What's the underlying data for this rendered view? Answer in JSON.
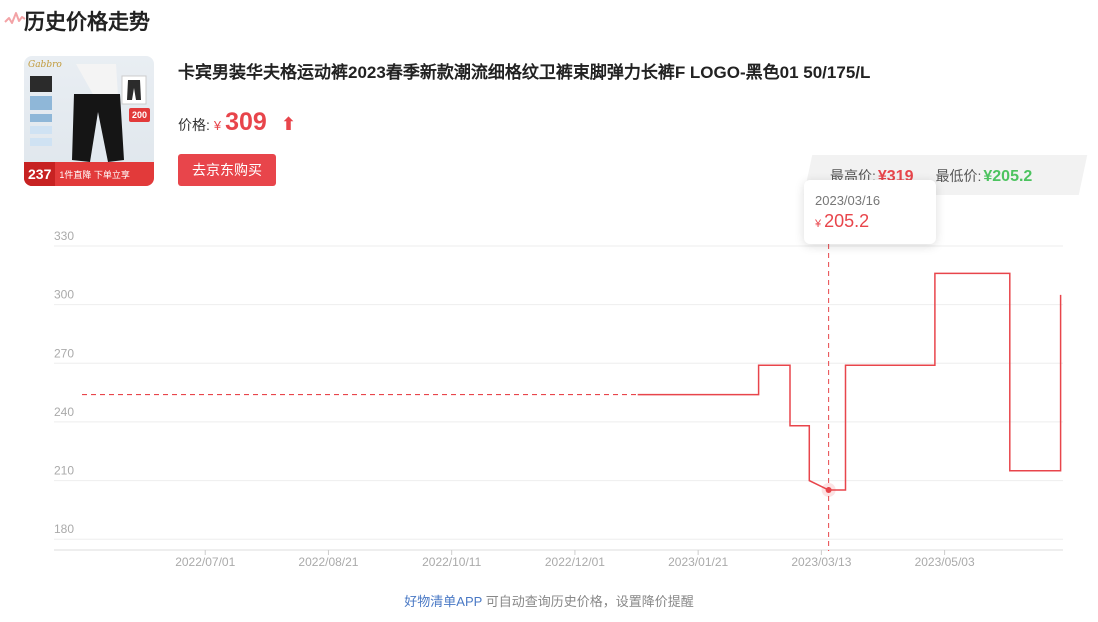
{
  "page": {
    "title": "历史价格走势"
  },
  "product": {
    "image_brand_text": "Gabbro",
    "image_badge": "200",
    "image_price": "237",
    "image_promo": "1件直降 下单立享",
    "title": "卡宾男装华夫格运动裤2023春季新款潮流细格纹卫裤束脚弹力长裤F LOGO-黑色01 50/175/L",
    "price_label": "价格:",
    "currency": "¥",
    "price": "309",
    "buy_button": "去京东购买"
  },
  "summary": {
    "high_label": "最高价:",
    "high_value": "¥319",
    "low_label": "最低价:",
    "low_value": "¥205.2"
  },
  "tooltip": {
    "date": "2023/03/16",
    "currency": "¥",
    "price": "205.2"
  },
  "footer": {
    "link": "好物清单APP",
    "text": " 可自动查询历史价格，设置降价提醒"
  },
  "colors": {
    "line": "#e8454b",
    "high": "#e8454b",
    "low": "#4cc35f"
  },
  "chart_data": {
    "type": "line",
    "x_start": "2022-05-11",
    "x_end": "2023-06-21",
    "x_ticks": [
      "2022/07/01",
      "2022/08/21",
      "2022/10/11",
      "2022/12/01",
      "2023/01/21",
      "2023/03/13",
      "2023/05/03"
    ],
    "y_ticks": [
      330,
      300,
      270,
      240,
      210,
      180
    ],
    "ylim": [
      175,
      330
    ],
    "dashed_segment": [
      {
        "x": "2022-05-11",
        "y": 254
      },
      {
        "x": "2022-12-27",
        "y": 254
      }
    ],
    "series": [
      {
        "values": [
          {
            "x": "2022-12-27",
            "y": 254
          },
          {
            "x": "2023-02-15",
            "y": 254
          },
          {
            "x": "2023-02-15",
            "y": 269
          },
          {
            "x": "2023-02-28",
            "y": 269
          },
          {
            "x": "2023-02-28",
            "y": 238
          },
          {
            "x": "2023-03-08",
            "y": 238
          },
          {
            "x": "2023-03-08",
            "y": 210
          },
          {
            "x": "2023-03-16",
            "y": 205.2
          },
          {
            "x": "2023-03-23",
            "y": 205.2
          },
          {
            "x": "2023-03-23",
            "y": 269
          },
          {
            "x": "2023-04-29",
            "y": 269
          },
          {
            "x": "2023-04-29",
            "y": 316
          },
          {
            "x": "2023-05-30",
            "y": 316
          },
          {
            "x": "2023-05-30",
            "y": 215
          },
          {
            "x": "2023-06-20",
            "y": 215
          },
          {
            "x": "2023-06-20",
            "y": 305
          }
        ]
      }
    ],
    "highlight": {
      "x": "2023-03-16",
      "y": 205.2
    },
    "grid": true
  }
}
